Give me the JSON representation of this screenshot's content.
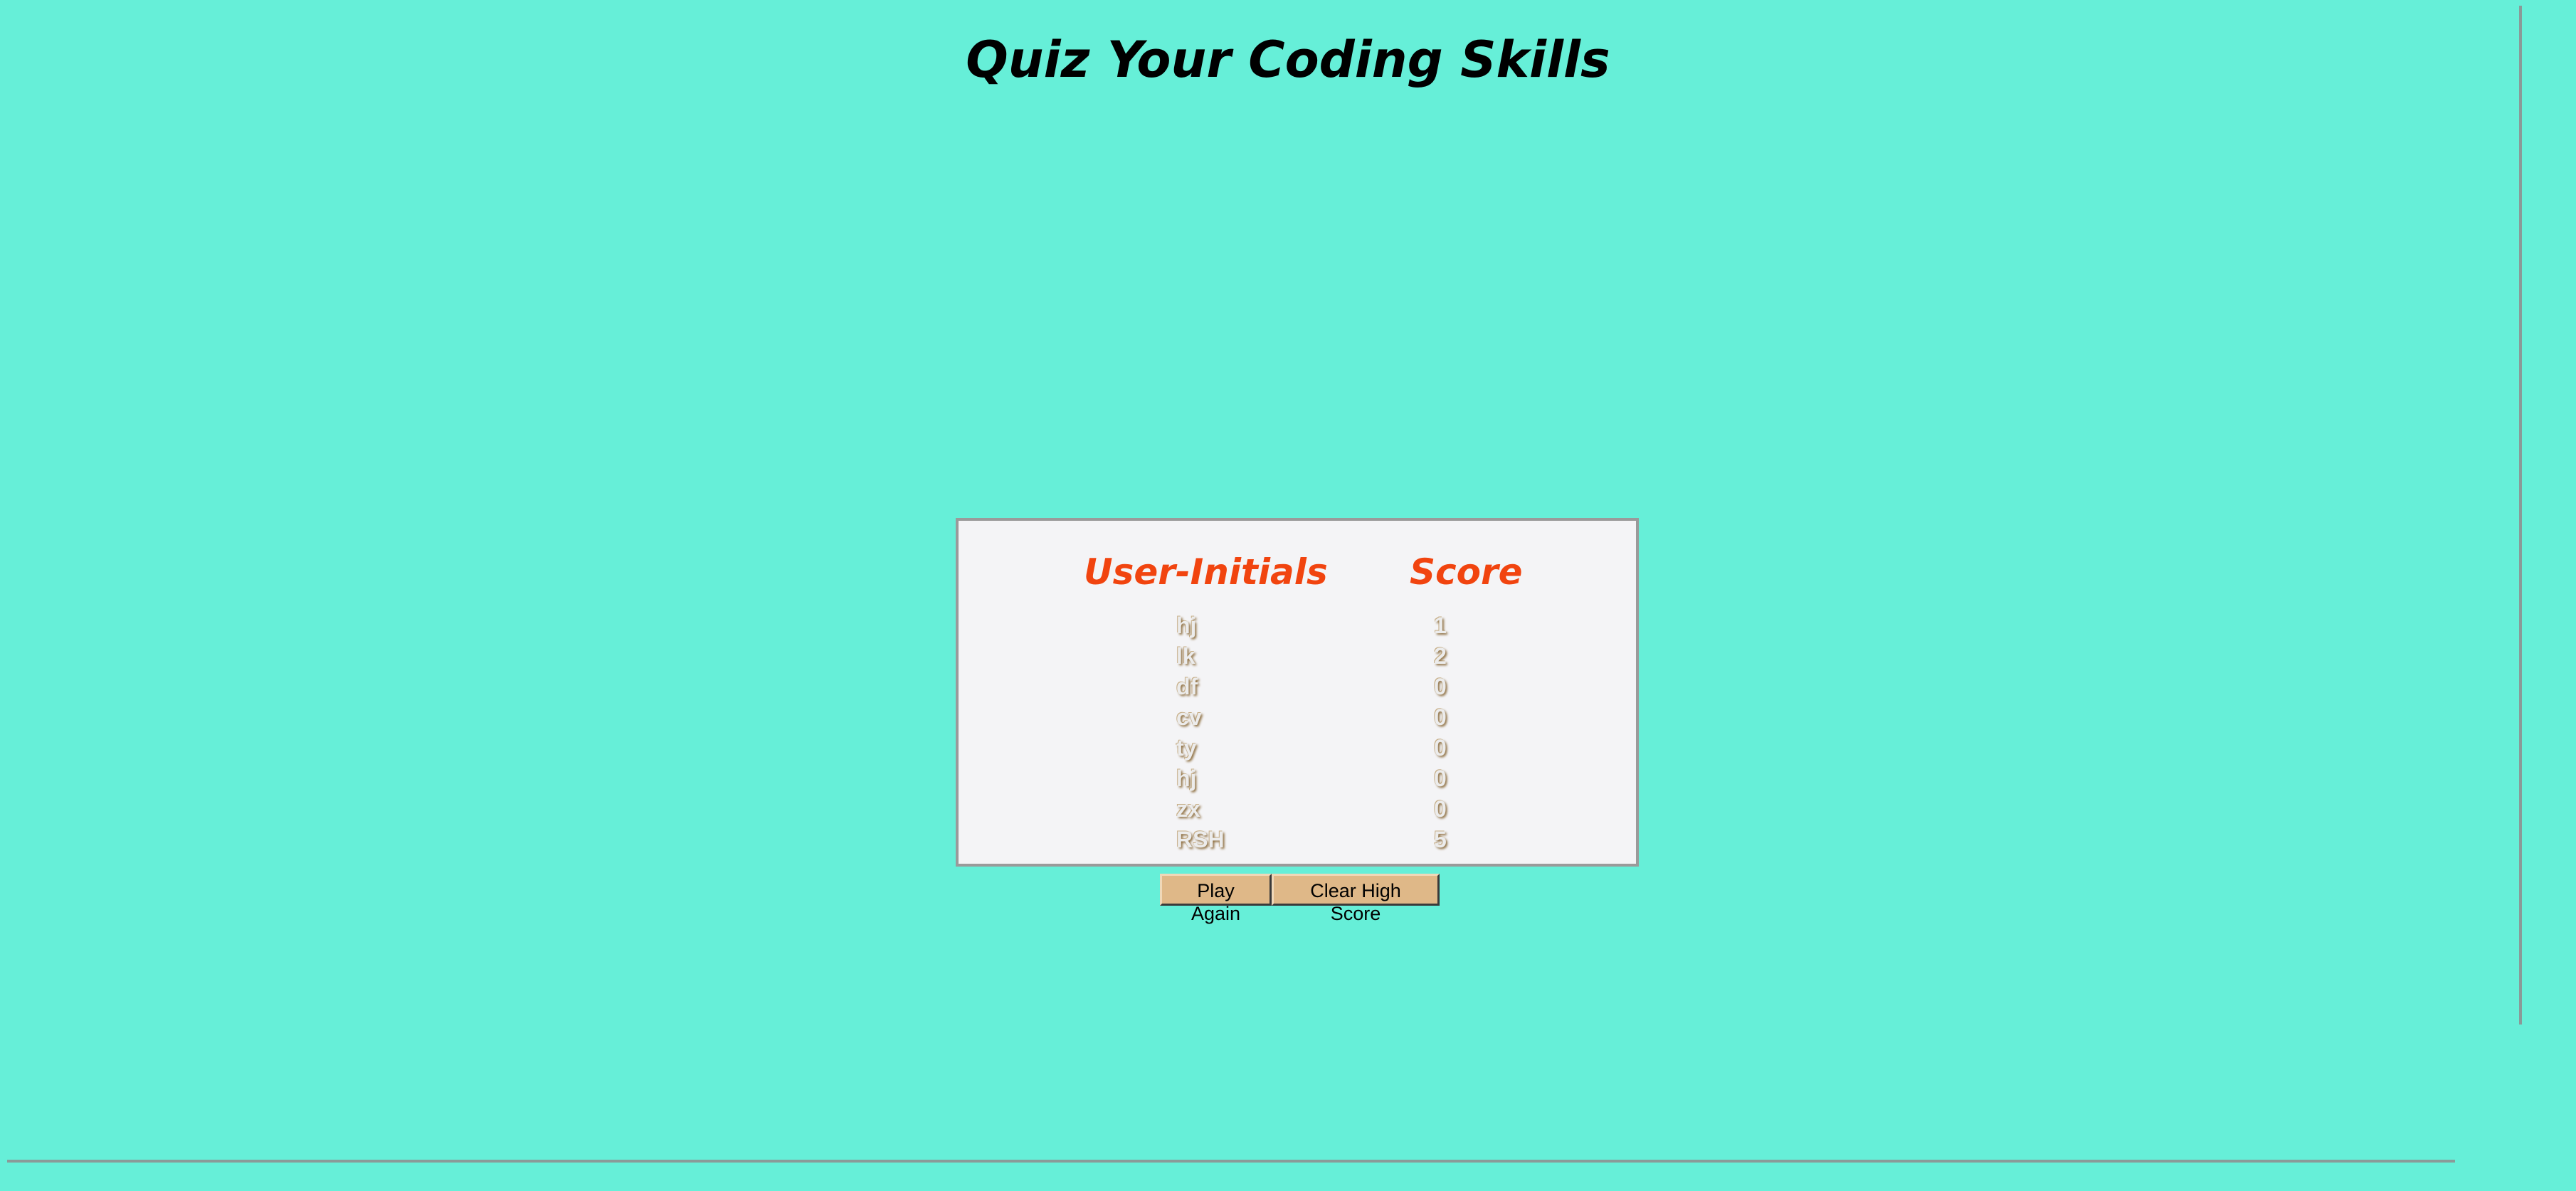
{
  "page": {
    "title": "Quiz Your Coding Skills"
  },
  "scoreboard": {
    "headers": {
      "initials": "User-Initials",
      "score": "Score"
    },
    "entries": [
      {
        "initials": "hj",
        "score": "1"
      },
      {
        "initials": "lk",
        "score": "2"
      },
      {
        "initials": "df",
        "score": "0"
      },
      {
        "initials": "cv",
        "score": "0"
      },
      {
        "initials": "ty",
        "score": "0"
      },
      {
        "initials": "hj",
        "score": "0"
      },
      {
        "initials": "zx",
        "score": "0"
      },
      {
        "initials": "RSH",
        "score": "5"
      }
    ]
  },
  "actions": {
    "play_again_label": "Play Again",
    "clear_label": "Clear High Score"
  },
  "colors": {
    "background": "#66efd8",
    "header_accent": "#f1440f",
    "button_fill": "#dfb888",
    "panel_fill": "#f4f4f6"
  }
}
